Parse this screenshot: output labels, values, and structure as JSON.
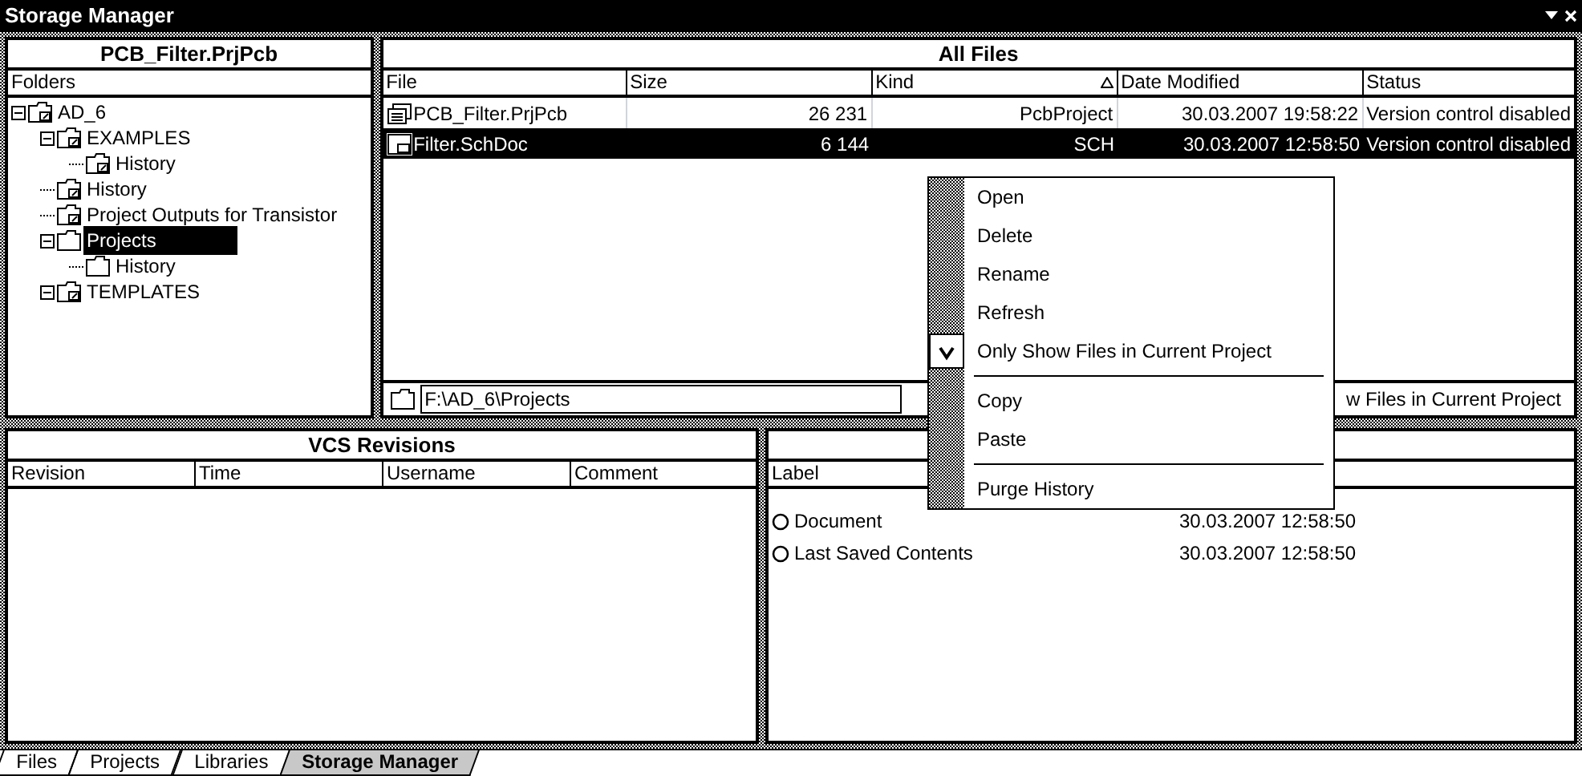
{
  "window": {
    "title": "Storage Manager"
  },
  "project_panel": {
    "title": "PCB_Filter.PrjPcb",
    "column": "Folders",
    "tree": [
      {
        "label": "AD_6",
        "kind": "linked",
        "expanded": true,
        "selected": false,
        "children": [
          {
            "label": "EXAMPLES",
            "kind": "linked",
            "expanded": true,
            "selected": false,
            "children": [
              {
                "label": "History",
                "kind": "linked",
                "selected": false
              }
            ]
          },
          {
            "label": "History",
            "kind": "linked",
            "selected": false
          },
          {
            "label": "Project Outputs for Transistor",
            "kind": "linked",
            "selected": false
          },
          {
            "label": "Projects",
            "kind": "plain",
            "expanded": true,
            "selected": true,
            "children": [
              {
                "label": "History",
                "kind": "plain",
                "selected": false
              }
            ]
          },
          {
            "label": "TEMPLATES",
            "kind": "linked",
            "expanded": true,
            "selected": false
          }
        ]
      }
    ]
  },
  "files_panel": {
    "title": "All Files",
    "columns": [
      "File",
      "Size",
      "Kind",
      "Date Modified",
      "Status"
    ],
    "rows": [
      {
        "kind": "project",
        "selected": false,
        "cells": [
          "PCB_Filter.PrjPcb",
          "26 231",
          "PcbProject",
          "30.03.2007 19:58:22",
          "Version control disabled"
        ]
      },
      {
        "kind": "schematic",
        "selected": true,
        "cells": [
          "Filter.SchDoc",
          "6 144",
          "SCH",
          "30.03.2007 12:58:50",
          "Version control disabled"
        ]
      }
    ],
    "path": "F:\\AD_6\\Projects",
    "option_label": "w Files in Current Project"
  },
  "vcs_panel": {
    "title": "VCS Revisions",
    "columns": [
      "Revision",
      "Time",
      "Username",
      "Comment"
    ]
  },
  "history_panel": {
    "columns": [
      "Label"
    ],
    "rows": [
      {
        "label": "Document",
        "date": "30.03.2007 12:58:50"
      },
      {
        "label": "Last Saved Contents",
        "date": "30.03.2007 12:58:50"
      }
    ]
  },
  "context_menu": [
    {
      "kind": "item",
      "label": "Open",
      "checked": false
    },
    {
      "kind": "item",
      "label": "Delete",
      "checked": false
    },
    {
      "kind": "item",
      "label": "Rename",
      "checked": false
    },
    {
      "kind": "item",
      "label": "Refresh",
      "checked": false
    },
    {
      "kind": "item",
      "label": "Only Show Files in Current Project",
      "checked": true
    },
    {
      "kind": "separator"
    },
    {
      "kind": "item",
      "label": "Copy",
      "checked": false
    },
    {
      "kind": "item",
      "label": "Paste",
      "checked": false
    },
    {
      "kind": "separator"
    },
    {
      "kind": "item",
      "label": "Purge History",
      "checked": false
    }
  ],
  "tabs": [
    {
      "label": "Files",
      "selected": false
    },
    {
      "label": "Projects",
      "selected": false
    },
    {
      "label": "Libraries",
      "selected": false
    },
    {
      "label": "Storage Manager",
      "selected": true
    }
  ]
}
